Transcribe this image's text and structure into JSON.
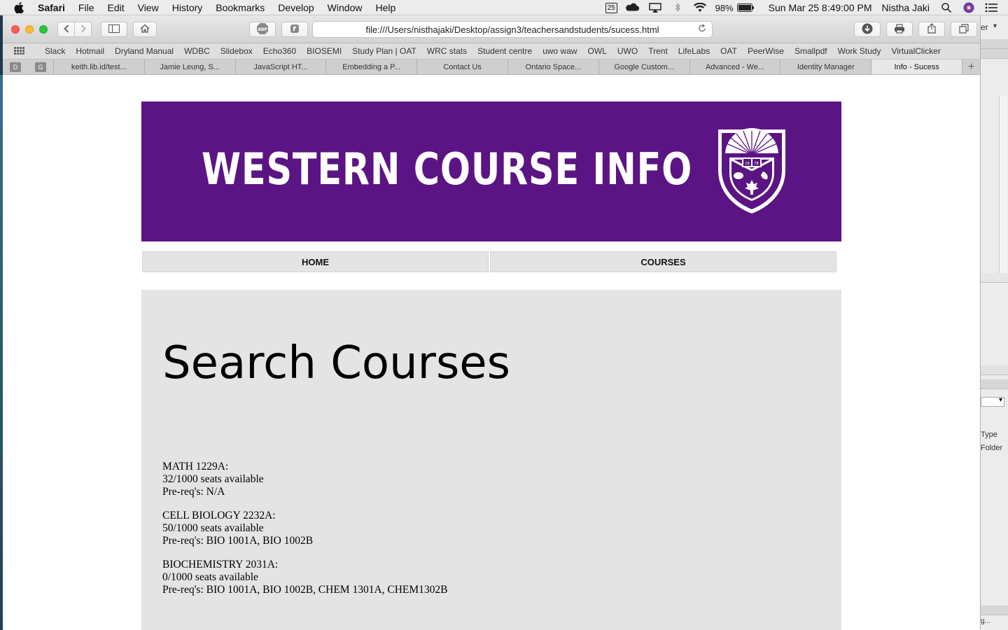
{
  "menubar": {
    "app_name": "Safari",
    "items": [
      "File",
      "Edit",
      "View",
      "History",
      "Bookmarks",
      "Develop",
      "Window",
      "Help"
    ],
    "calendar_day": "25",
    "battery": "98%",
    "datetime": "Sun Mar 25  8:49:00 PM",
    "user": "Nistha Jaki"
  },
  "browser": {
    "url": "file:///Users/nisthajaki/Desktop/assign3/teachersandstudents/sucess.html",
    "bookmarks": [
      "Slack",
      "Hotmail",
      "Dryland Manual",
      "WDBC",
      "Slidebox",
      "Echo360",
      "BIOSEMI",
      "Study Plan | OAT",
      "WRC stats",
      "Student centre",
      "uwo waw",
      "OWL",
      "UWO",
      "Trent",
      "LifeLabs",
      "OAT",
      "PeerWise",
      "Smallpdf",
      "Work Study",
      "VirtualClicker"
    ],
    "pinned_tabs": [
      "D",
      "G"
    ],
    "tabs": [
      "keith.lib.id/test...",
      "Jamie Leung, S...",
      "JavaScript HT...",
      "Embedding a P...",
      "Contact Us",
      "Ontario Space...",
      "Google Custom...",
      "Advanced - We...",
      "Identity Manager",
      "Info - Sucess"
    ],
    "active_tab_index": 9
  },
  "page": {
    "banner_title": "WESTERN COURSE INFO",
    "crest_year": "1878",
    "nav": {
      "home": "HOME",
      "courses": "COURSES"
    },
    "heading": "Search Courses",
    "courses": [
      {
        "name": "MATH 1229A:",
        "seats": "32/1000 seats available",
        "prereq": "Pre-req's: N/A"
      },
      {
        "name": "CELL BIOLOGY 2232A:",
        "seats": "50/1000 seats available",
        "prereq": "Pre-req's: BIO 1001A, BIO 1002B"
      },
      {
        "name": "BIOCHEMISTRY 2031A:",
        "seats": "0/1000 seats available",
        "prereq": "Pre-req's: BIO 1001A, BIO 1002B, CHEM 1301A, CHEM1302B"
      }
    ]
  },
  "side_window": {
    "title_fragment": "er",
    "type_label": "Type",
    "folder_label": "Folder",
    "bottom_fragment": "g..."
  }
}
